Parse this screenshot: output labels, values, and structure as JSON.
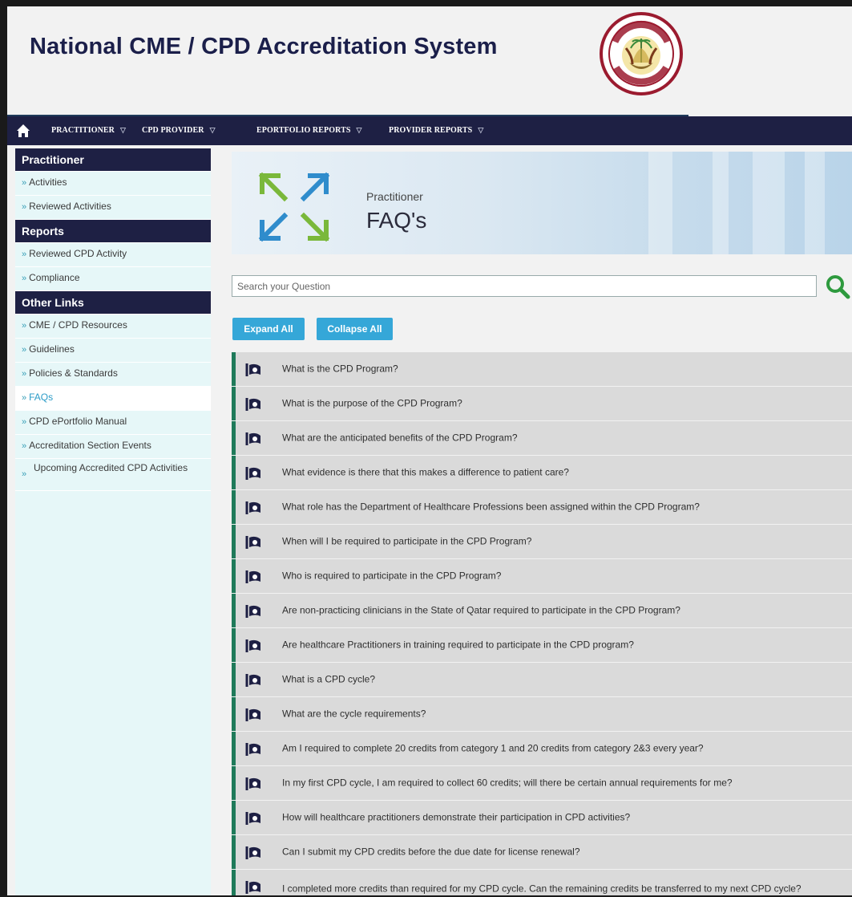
{
  "header": {
    "title": "National CME / CPD Accreditation System"
  },
  "nav": {
    "items": [
      {
        "label": "PRACTITIONER"
      },
      {
        "label": "CPD PROVIDER"
      },
      {
        "label": "EPORTFOLIO REPORTS"
      },
      {
        "label": "PROVIDER REPORTS"
      }
    ]
  },
  "sidebar": {
    "practitioner": {
      "heading": "Practitioner",
      "links": [
        "Activities",
        "Reviewed Activities"
      ]
    },
    "reports": {
      "heading": "Reports",
      "links": [
        "Reviewed CPD Activity",
        "Compliance"
      ]
    },
    "other": {
      "heading": "Other Links",
      "links": [
        "CME / CPD Resources",
        "Guidelines",
        "Policies & Standards",
        "FAQs",
        "CPD ePortfolio Manual",
        "Accreditation Section Events",
        "Upcoming Accredited CPD Activities"
      ],
      "active": "FAQs"
    }
  },
  "banner": {
    "subtitle": "Practitioner",
    "title": "FAQ's"
  },
  "search": {
    "placeholder": "Search your Question"
  },
  "buttons": {
    "expand": "Expand All",
    "collapse": "Collapse All"
  },
  "faqs": [
    "What is the CPD Program?",
    "What is the purpose of the CPD Program?",
    "What are the anticipated benefits of the CPD Program?",
    "What evidence is there that this makes a difference to patient care?",
    "What role has the Department of Healthcare Professions been assigned within the CPD Program?",
    "When will I be required to participate in the CPD Program?",
    "Who is required to participate in the CPD Program?",
    "Are non-practicing clinicians in the State of Qatar required to participate in the CPD Program?",
    "Are healthcare Practitioners in training required to participate in the CPD program?",
    "What is a CPD cycle?",
    "What are the cycle requirements?",
    "Am I required to complete 20 credits from category 1 and 20 credits from category 2&3 every year?",
    "In my first CPD cycle, I am required to collect 60 credits; will there be certain annual requirements for me?",
    "How will healthcare practitioners demonstrate their participation in CPD activities?",
    "Can I submit my CPD credits before the due date for license renewal?",
    "I completed more credits than required for my CPD cycle. Can the remaining credits be transferred to my next CPD cycle?"
  ],
  "colors": {
    "navy": "#1e2044",
    "accent": "#35a7d8",
    "faq_border": "#1f7a5a"
  }
}
